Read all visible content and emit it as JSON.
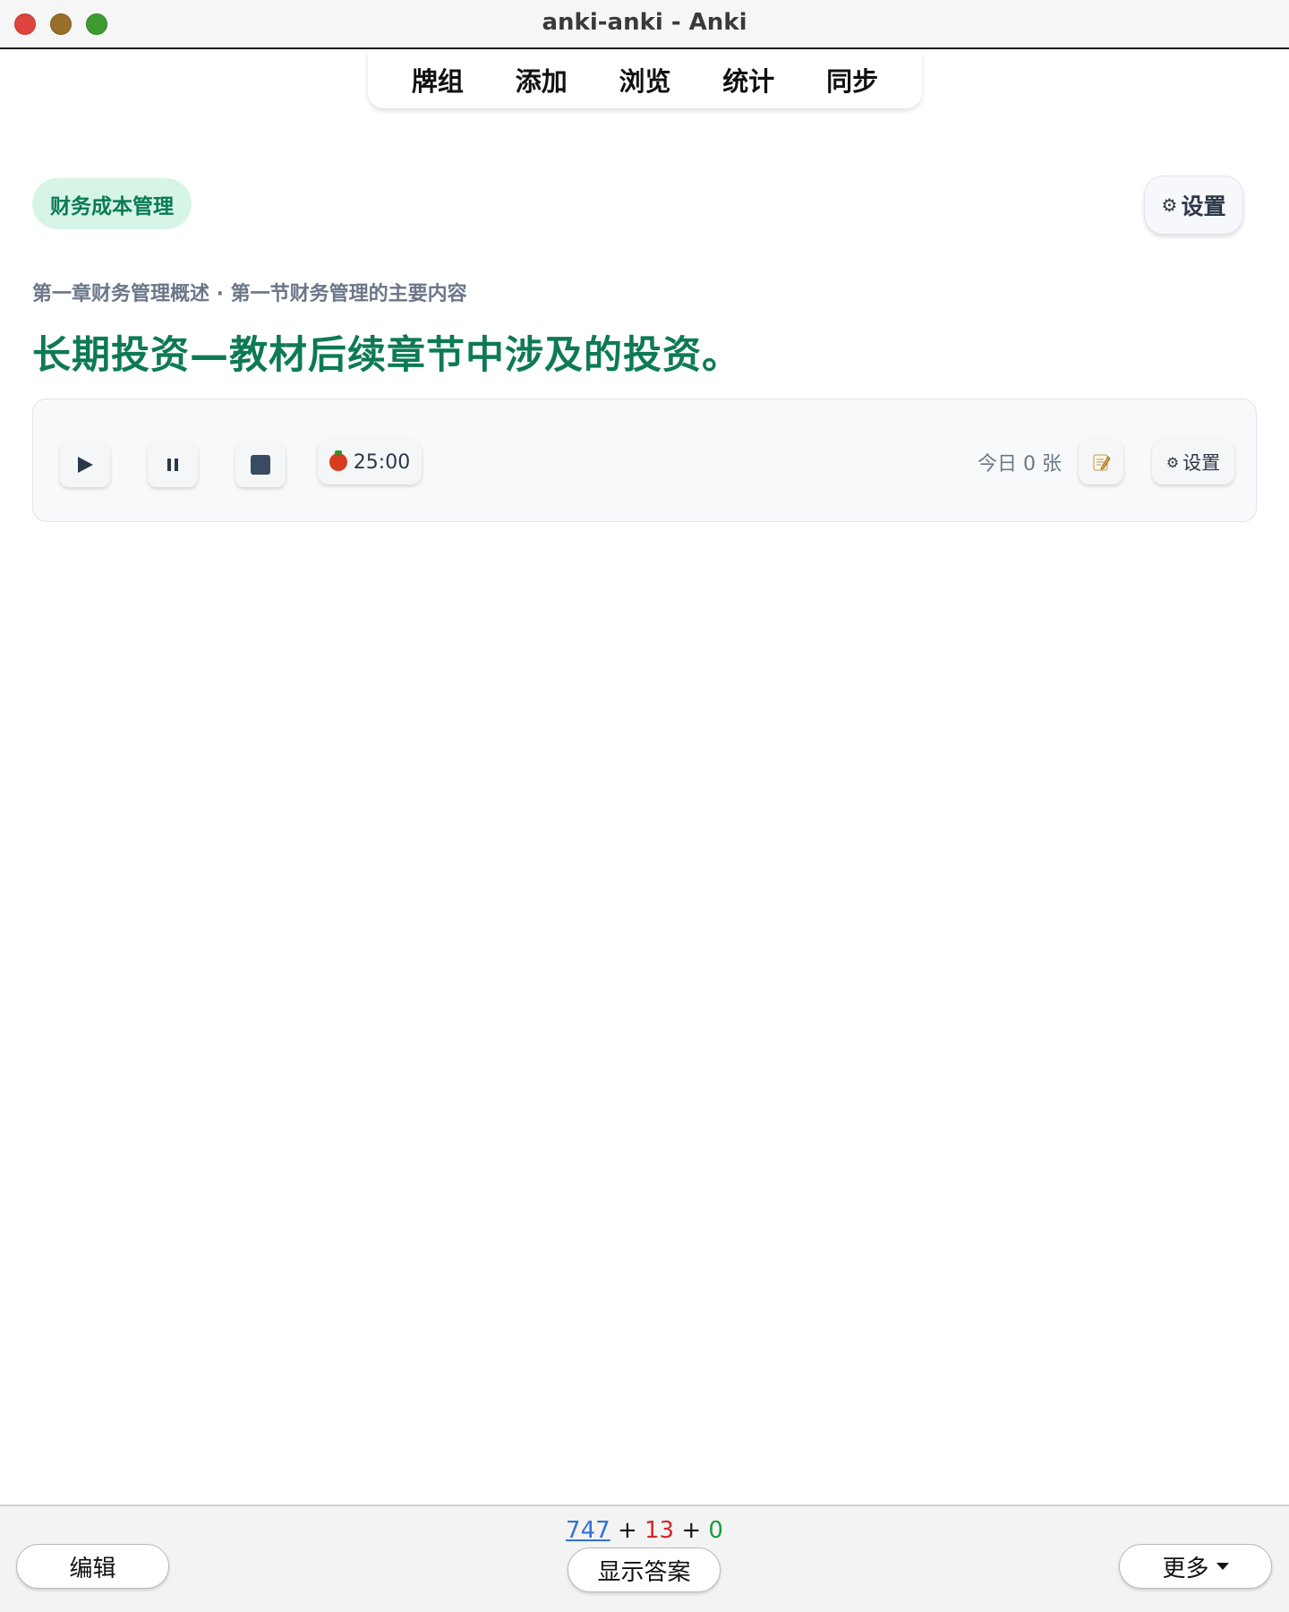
{
  "window": {
    "title": "anki-anki - Anki"
  },
  "topnav": {
    "items": [
      "牌组",
      "添加",
      "浏览",
      "统计",
      "同步"
    ]
  },
  "header": {
    "deck_name": "财务成本管理",
    "settings_label": "设置",
    "settings_icon": "gear-icon"
  },
  "card": {
    "breadcrumb": "第一章财务管理概述 · 第一节财务管理的主要内容",
    "question": "长期投资—教材后续章节中涉及的投资。"
  },
  "pomodoro": {
    "timer": "25:00",
    "today_count": "今日 0 张",
    "settings_label": "设置",
    "icons": [
      "play-icon",
      "pause-icon",
      "stop-icon",
      "tomato-icon",
      "memo-icon",
      "gear-icon"
    ]
  },
  "bottombar": {
    "count_new": "747",
    "plus1": "+",
    "count_learn": "13",
    "plus2": "+",
    "count_review": "0",
    "edit_label": "编辑",
    "show_answer_label": "显示答案",
    "more_label": "更多"
  },
  "colors": {
    "accent_green": "#0e7a55",
    "chip_bg": "#d6f5e6",
    "new_blue": "#2f73d8",
    "learn_red": "#d6262a",
    "review_green": "#19a03a"
  }
}
